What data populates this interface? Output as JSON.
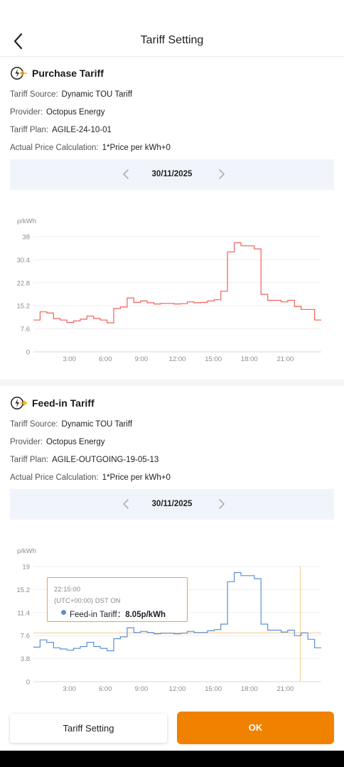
{
  "header": {
    "title": "Tariff Setting",
    "back_icon": "chevron-left-icon"
  },
  "purchase": {
    "title": "Purchase Tariff",
    "icon": "lightning-arrow-in-icon",
    "rows": [
      {
        "label": "Tariff Source:",
        "value": "Dynamic TOU Tariff"
      },
      {
        "label": "Provider:",
        "value": "Octopus Energy"
      },
      {
        "label": "Tariff Plan:",
        "value": "AGILE-24-10-01"
      },
      {
        "label": "Actual Price Calculation:",
        "value": "1*Price per kWh+0"
      }
    ],
    "date": "30/11/2025"
  },
  "feedin": {
    "title": "Feed-in Tariff",
    "icon": "lightning-arrow-out-icon",
    "rows": [
      {
        "label": "Tariff Source:",
        "value": "Dynamic TOU Tariff"
      },
      {
        "label": "Provider:",
        "value": "Octopus Energy"
      },
      {
        "label": "Tariff Plan:",
        "value": "AGILE-OUTGOING-19-05-13"
      },
      {
        "label": "Actual Price Calculation:",
        "value": "1*Price per kWh+0"
      }
    ],
    "date": "30/11/2025",
    "tooltip": {
      "time": "22:15:00",
      "zone": "(UTC+00:00)  DST ON",
      "series_label": "Feed-in Tariff：",
      "value_text": "8.05p/kWh"
    }
  },
  "chart_data": [
    {
      "type": "line",
      "step": true,
      "unit_label": "p/kWh",
      "color": "#f0605a",
      "y_ticks": [
        "38",
        "30.4",
        "22.8",
        "15.2",
        "7.6",
        "0"
      ],
      "x_ticks": [
        "3:00",
        "6:00",
        "9:00",
        "12:00",
        "15:00",
        "18:00",
        "21:00"
      ],
      "ylim": [
        0,
        38
      ],
      "xlim": [
        0,
        24
      ],
      "values": [
        10.5,
        13.2,
        12.8,
        11.0,
        10.5,
        9.7,
        10.2,
        10.8,
        11.8,
        11.0,
        10.5,
        9.6,
        14.3,
        14.8,
        17.8,
        16.3,
        16.8,
        16.2,
        15.8,
        16.0,
        16.0,
        15.8,
        15.9,
        16.5,
        16.2,
        16.3,
        16.8,
        17.2,
        20.0,
        33.0,
        36.0,
        35.0,
        35.0,
        34.0,
        19.0,
        17.0,
        17.0,
        16.5,
        17.0,
        15.0,
        14.0,
        14.0,
        10.5
      ],
      "grid": true
    },
    {
      "type": "line",
      "step": true,
      "unit_label": "p/kWh",
      "color": "#5b8fd6",
      "y_ticks": [
        "19",
        "15.2",
        "11.4",
        "7.6",
        "3.8",
        "0"
      ],
      "x_ticks": [
        "3:00",
        "6:00",
        "9:00",
        "12:00",
        "15:00",
        "18:00",
        "21:00"
      ],
      "ylim": [
        0,
        19
      ],
      "xlim": [
        0,
        24
      ],
      "values": [
        5.7,
        6.9,
        6.5,
        5.6,
        5.4,
        5.2,
        5.5,
        5.8,
        6.5,
        5.8,
        5.5,
        5.1,
        7.1,
        7.4,
        8.9,
        8.1,
        8.3,
        8.1,
        7.9,
        8.0,
        8.0,
        7.9,
        8.0,
        8.3,
        8.1,
        8.1,
        8.4,
        8.6,
        9.5,
        16.5,
        18.0,
        17.5,
        17.5,
        17.0,
        9.5,
        8.5,
        8.5,
        8.2,
        8.5,
        7.6,
        8.05,
        7.0,
        5.6
      ],
      "grid": true,
      "cursor_x": 22.25,
      "cursor_y": 8.05
    }
  ],
  "footer": {
    "secondary_label": "Tariff Setting",
    "primary_label": "OK"
  }
}
